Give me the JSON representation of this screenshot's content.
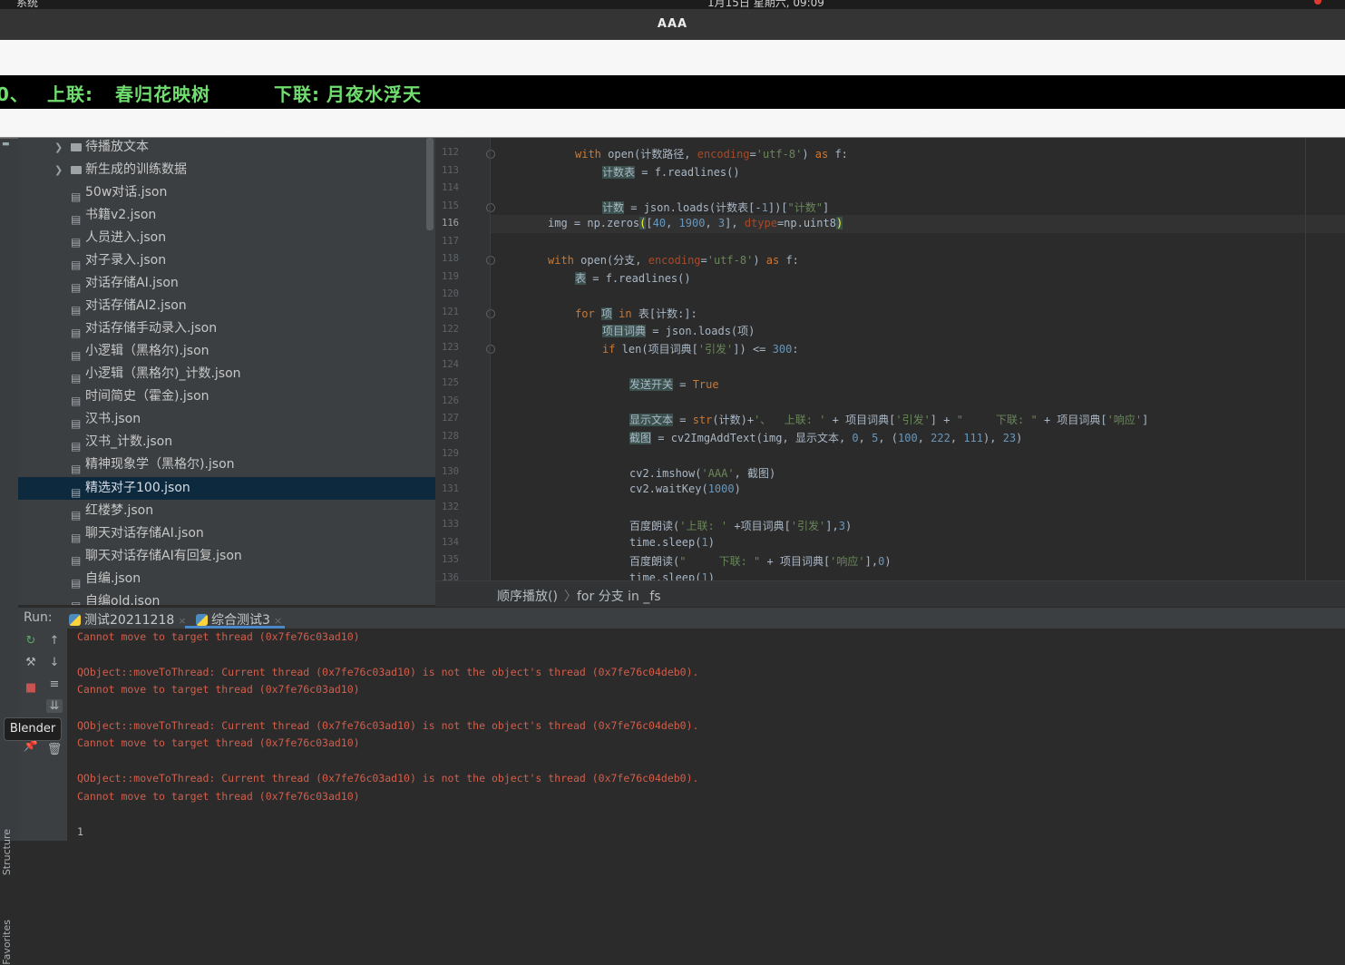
{
  "system_bar": {
    "left_text": "系统",
    "center_text": "1月15日 星期六, 09:09"
  },
  "window": {
    "title": "AAA"
  },
  "cv_output": {
    "prefix": "0、",
    "upper_label": "上联:",
    "upper_text": "春归花映树",
    "lower_label": "下联:",
    "lower_text": "月夜水浮天"
  },
  "side_tools": {
    "structure": "Structure",
    "favorites": "Favorites"
  },
  "project_tree": {
    "items": [
      {
        "label": "待播放文本",
        "type": "folder"
      },
      {
        "label": "新生成的训练数据",
        "type": "folder"
      },
      {
        "label": "50w对话.json",
        "type": "json"
      },
      {
        "label": "书籍v2.json",
        "type": "json"
      },
      {
        "label": "人员进入.json",
        "type": "json"
      },
      {
        "label": "对子录入.json",
        "type": "json"
      },
      {
        "label": "对话存储AI.json",
        "type": "json"
      },
      {
        "label": "对话存储AI2.json",
        "type": "json"
      },
      {
        "label": "对话存储手动录入.json",
        "type": "json"
      },
      {
        "label": "小逻辑（黑格尔).json",
        "type": "json"
      },
      {
        "label": "小逻辑（黑格尔)_计数.json",
        "type": "json"
      },
      {
        "label": "时间简史（霍金).json",
        "type": "json"
      },
      {
        "label": "汉书.json",
        "type": "json"
      },
      {
        "label": "汉书_计数.json",
        "type": "json"
      },
      {
        "label": "精神现象学（黑格尔).json",
        "type": "json"
      },
      {
        "label": "精选对子100.json",
        "type": "json",
        "selected": true
      },
      {
        "label": "红楼梦.json",
        "type": "json"
      },
      {
        "label": "聊天对话存储AI.json",
        "type": "json"
      },
      {
        "label": "聊天对话存储AI有回复.json",
        "type": "json"
      },
      {
        "label": "自编.json",
        "type": "json"
      },
      {
        "label": "自编old.json",
        "type": "json"
      }
    ]
  },
  "editor": {
    "line_numbers": [
      "112",
      "113",
      "114",
      "115",
      "116",
      "117",
      "118",
      "119",
      "120",
      "121",
      "122",
      "123",
      "124",
      "125",
      "126",
      "127",
      "128",
      "129",
      "130",
      "131",
      "132",
      "133",
      "134",
      "135",
      "136"
    ],
    "current_line": "116"
  },
  "breadcrumb": {
    "func": "顺序播放()",
    "sep": "〉",
    "loop": "for 分支 in _fs"
  },
  "run_panel": {
    "label": "Run:",
    "tabs": [
      {
        "label": "测试20211218",
        "close": "×"
      },
      {
        "label": "综合测试3",
        "close": "×"
      }
    ],
    "console_lines": [
      {
        "text": "Cannot move to target thread (0x7fe76c03ad10)",
        "kind": "error"
      },
      {
        "text": "",
        "kind": "blank"
      },
      {
        "text": "QObject::moveToThread: Current thread (0x7fe76c03ad10) is not the object's thread (0x7fe76c04deb0).",
        "kind": "error"
      },
      {
        "text": "Cannot move to target thread (0x7fe76c03ad10)",
        "kind": "error"
      },
      {
        "text": "",
        "kind": "blank"
      },
      {
        "text": "QObject::moveToThread: Current thread (0x7fe76c03ad10) is not the object's thread (0x7fe76c04deb0).",
        "kind": "error"
      },
      {
        "text": "Cannot move to target thread (0x7fe76c03ad10)",
        "kind": "error"
      },
      {
        "text": "",
        "kind": "blank"
      },
      {
        "text": "QObject::moveToThread: Current thread (0x7fe76c03ad10) is not the object's thread (0x7fe76c04deb0).",
        "kind": "error"
      },
      {
        "text": "Cannot move to target thread (0x7fe76c03ad10)",
        "kind": "error"
      },
      {
        "text": "",
        "kind": "blank"
      },
      {
        "text": "1",
        "kind": "plain"
      }
    ],
    "tooltip": "Blender"
  },
  "colors": {
    "accent": "#4a88c7",
    "selection": "#0d293e",
    "error_text": "#d25e4b",
    "cv_text": "#6fde6f"
  }
}
